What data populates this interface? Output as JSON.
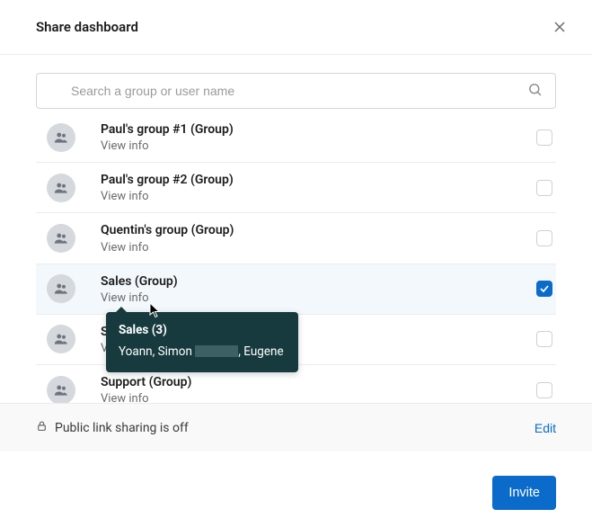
{
  "header": {
    "title": "Share dashboard"
  },
  "search": {
    "placeholder": "Search a group or user name"
  },
  "groups": [
    {
      "title": "Paul's group #1 (Group)",
      "sub": "View info",
      "checked": false,
      "selected": false
    },
    {
      "title": "Paul's group #2 (Group)",
      "sub": "View info",
      "checked": false,
      "selected": false
    },
    {
      "title": "Quentin's group (Group)",
      "sub": "View info",
      "checked": false,
      "selected": false
    },
    {
      "title": "Sales (Group)",
      "sub": "View info",
      "checked": true,
      "selected": true
    },
    {
      "title": "S",
      "sub": "V",
      "checked": false,
      "selected": false
    },
    {
      "title": "Support (Group)",
      "sub": "View info",
      "checked": false,
      "selected": false
    }
  ],
  "tooltip": {
    "title": "Sales (3)",
    "members_prefix": "Yoann, Simon ",
    "members_suffix": ", Eugene"
  },
  "footer": {
    "text": "Public link sharing is off",
    "edit": "Edit"
  },
  "actions": {
    "invite": "Invite"
  }
}
